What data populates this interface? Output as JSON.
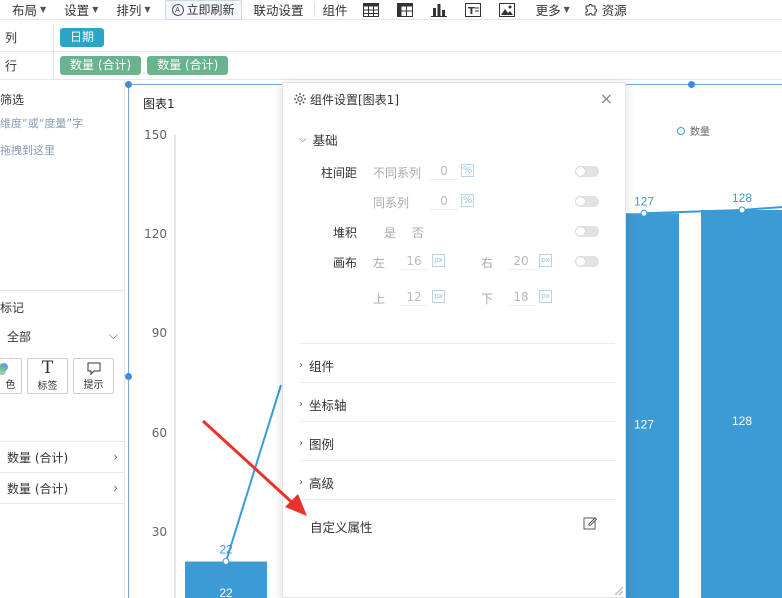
{
  "toolbar": {
    "layout": "布局",
    "settings": "设置",
    "arrange": "排列",
    "refresh": "立即刷新",
    "linkage": "联动设置",
    "component": "组件",
    "more": "更多",
    "resources": "资源"
  },
  "shelves": {
    "column_label": "列",
    "column_pill": "日期",
    "row_label": "行",
    "row_pills": [
      "数量 (合计)",
      "数量 (合计)"
    ]
  },
  "left_panel": {
    "filter_title": "筛选",
    "filter_hint": "维度”或“度量”字",
    "filter_hint2": "拖拽到这里",
    "mark_title": "标记",
    "all_select": "全部",
    "mark_buttons": {
      "color": "颜色",
      "label": "标签",
      "tooltip": "提示"
    },
    "color_partial": "色",
    "label_glyph": "T",
    "fields": [
      "数量 (合计)",
      "数量 (合计)"
    ]
  },
  "chart": {
    "title": "图表1",
    "legend": "数量",
    "y_ticks": [
      "150",
      "120",
      "90",
      "60",
      "30"
    ]
  },
  "chart_data": {
    "type": "bar",
    "title": "图表1",
    "series": [
      {
        "name": "数量",
        "values": [
          22,
          127,
          128
        ]
      }
    ],
    "ylim": [
      0,
      150
    ],
    "y_ticks": [
      150,
      120,
      90,
      60,
      30
    ],
    "visible_value_labels": [
      "22",
      "127",
      "128"
    ],
    "legend_position": "top-right"
  },
  "dialog": {
    "title": "组件设置[图表1]",
    "basic": "基础",
    "bar_spacing": "柱间距",
    "diff_series": "不同系列",
    "same_series": "同系列",
    "stack": "堆积",
    "yes": "是",
    "no": "否",
    "layout": "画布",
    "left": "左",
    "right": "右",
    "top": "上",
    "bottom": "下",
    "diff_series_value": "0",
    "same_series_value": "0",
    "left_value": "16",
    "right_value": "20",
    "top_value": "12",
    "bottom_value": "18",
    "pct": "%",
    "px": "px",
    "component": "组件",
    "axis": "坐标轴",
    "legend": "图例",
    "advanced": "高级",
    "custom_props": "自定义属性",
    "close": "×"
  },
  "colors": {
    "bar": "#3b9bd5",
    "line": "#3b9bd5",
    "pill_blue": "#2aa5c5",
    "pill_green": "#6ab38f",
    "arrow": "#e8322b"
  }
}
